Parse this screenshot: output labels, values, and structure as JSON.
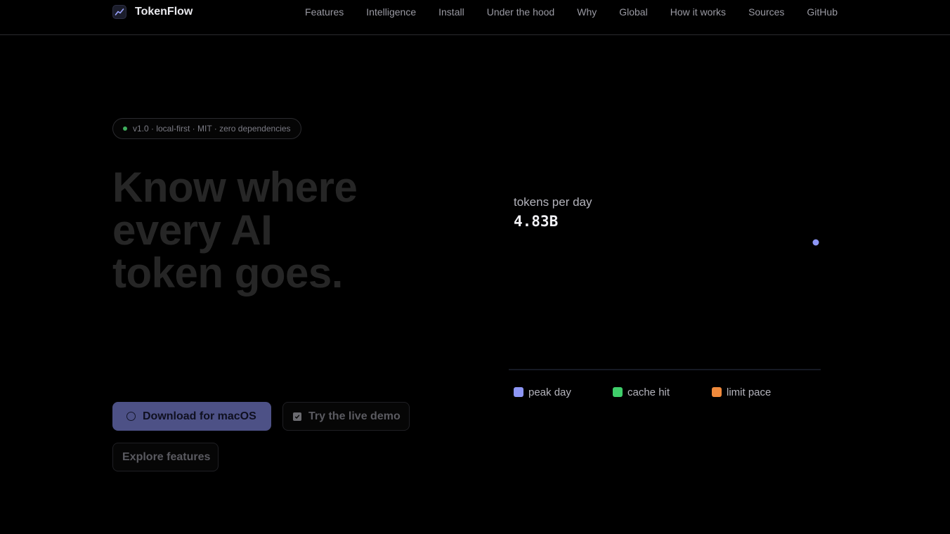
{
  "brand": {
    "name": "TokenFlow",
    "icon": "trend-chart-icon"
  },
  "nav": {
    "links": [
      "Features",
      "Intelligence",
      "Install",
      "Under the hood",
      "Why",
      "Global",
      "How it works",
      "Sources",
      "GitHub"
    ]
  },
  "hero": {
    "badge": "v1.0 · local-first · MIT · zero dependencies",
    "headline": [
      "Know where",
      "every AI",
      "token goes."
    ],
    "buttons": {
      "primary": "Download for macOS",
      "secondary": "Try the live demo",
      "tertiary": "Explore features"
    }
  },
  "chart": {
    "label": "tokens per day",
    "value": "4.83B",
    "legend": [
      {
        "label": "peak day",
        "color": "#8d96f5"
      },
      {
        "label": "cache hit",
        "color": "#3fce6a"
      },
      {
        "label": "limit pace",
        "color": "#f08a3c"
      }
    ],
    "accent": "#8d96f5",
    "baseline_color": "#2c3347"
  },
  "colors": {
    "background": "#000000",
    "primary_button": "#4d5186",
    "badge_dot": "#3fae5d"
  }
}
